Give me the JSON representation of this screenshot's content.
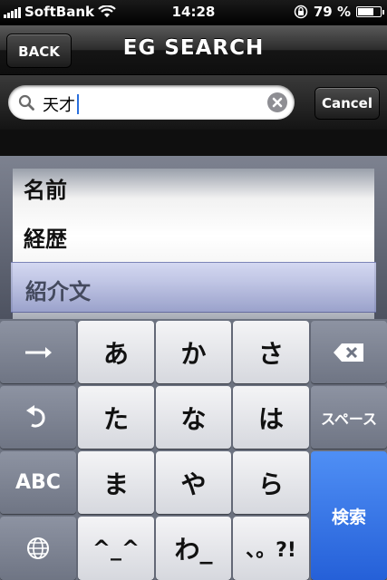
{
  "status_bar": {
    "carrier": "SoftBank",
    "time": "14:28",
    "battery_percent": "79 %",
    "battery_level": 0.79
  },
  "nav": {
    "back_label": "BACK",
    "title": "EG SEARCH"
  },
  "search": {
    "value": "天才",
    "cancel_label": "Cancel"
  },
  "picker": {
    "items": [
      "名前",
      "経歴",
      "紹介文"
    ],
    "selected": "紹介文"
  },
  "keyboard": {
    "row1": [
      "あ",
      "か",
      "さ"
    ],
    "row2": [
      "た",
      "な",
      "は"
    ],
    "row3": [
      "ま",
      "や",
      "ら"
    ],
    "row4": [
      "^_^",
      "わ_",
      "、。?!"
    ],
    "abc_label": "ABC",
    "space_label": "スペース",
    "search_label": "検索"
  },
  "colors": {
    "search_key": "#2a66dc",
    "caret": "#2a6fdd"
  }
}
